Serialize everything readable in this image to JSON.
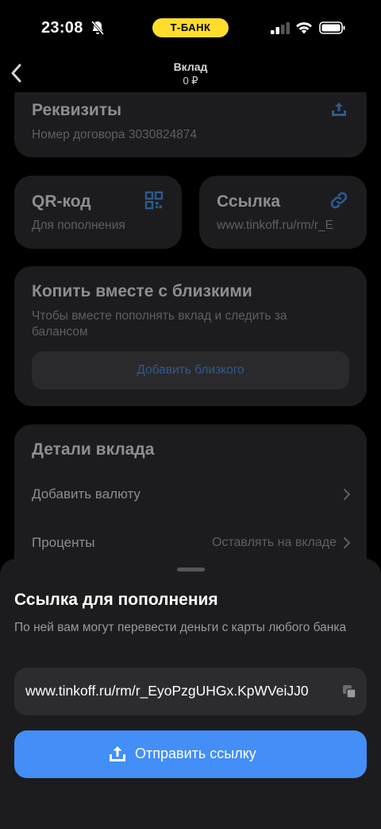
{
  "status_bar": {
    "time": "23:08",
    "bank_badge": "Т-БАНК"
  },
  "nav": {
    "title": "Вклад",
    "subtitle": "0 ₽"
  },
  "requisites": {
    "title": "Реквизиты",
    "contract": "Номер договора 3030824874"
  },
  "qr": {
    "title": "QR-код",
    "subtitle": "Для пополнения"
  },
  "link_card": {
    "title": "Ссылка",
    "subtitle": "www.tinkoff.ru/rm/r_E"
  },
  "save_together": {
    "title": "Копить вместе с близкими",
    "description": "Чтобы вместе пополнять вклад и следить за балансом",
    "button": "Добавить близкого"
  },
  "details": {
    "title": "Детали вклада",
    "add_currency": "Добавить валюту",
    "interest_label": "Проценты",
    "interest_value": "Оставлять на вкладе"
  },
  "sheet": {
    "title": "Ссылка для пополнения",
    "description": "По ней вам могут перевести деньги с карты любого банка",
    "link": "www.tinkoff.ru/rm/r_EyoPzgUHGx.KpWVeiJJ0",
    "send_button": "Отправить ссылку"
  },
  "colors": {
    "accent_blue": "#438ef7",
    "bank_yellow": "#ffdd2d",
    "sheet_bg": "#1c1c1e"
  }
}
